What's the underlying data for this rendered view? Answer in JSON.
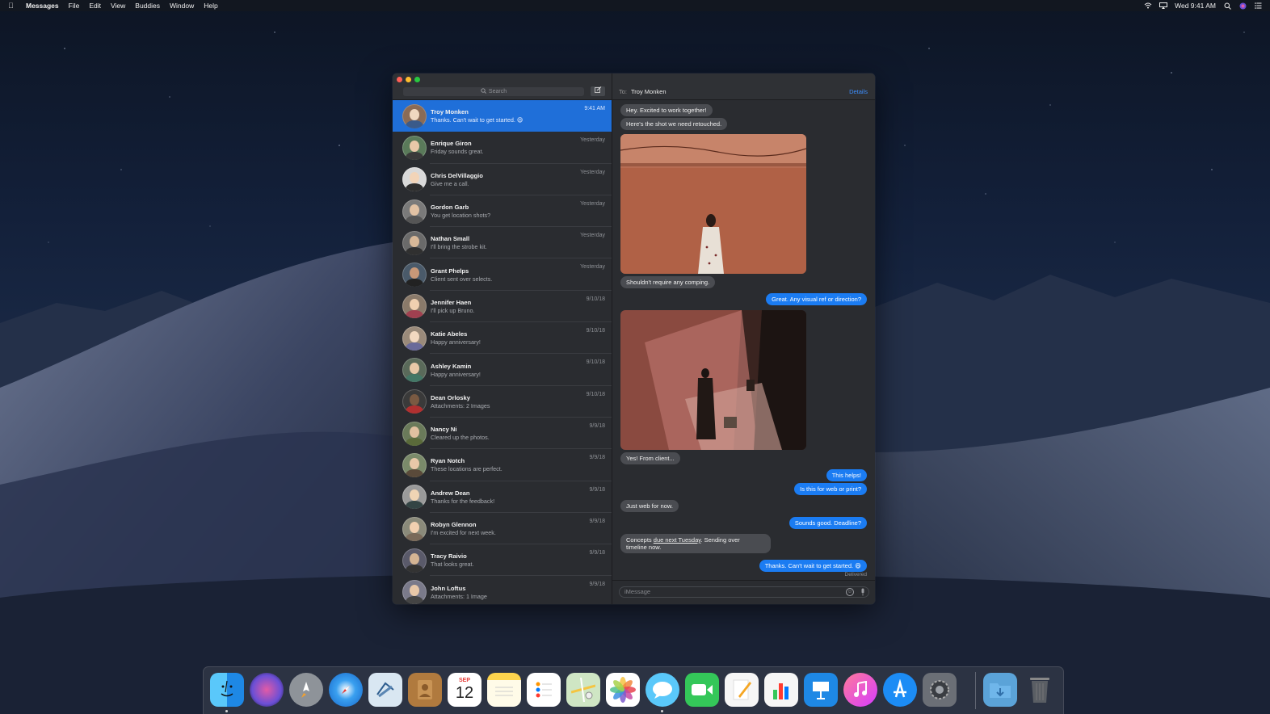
{
  "menubar": {
    "apple_icon": "apple-icon",
    "app_name": "Messages",
    "menus": [
      "File",
      "Edit",
      "View",
      "Buddies",
      "Window",
      "Help"
    ],
    "clock": "Wed 9:41 AM",
    "status_icons": [
      "wifi-icon",
      "airplay-icon",
      "spotlight-icon",
      "siri-icon",
      "notification-center-icon"
    ]
  },
  "window": {
    "search_placeholder": "Search",
    "compose_icon": "compose-icon",
    "conversations": [
      {
        "name": "Troy Monken",
        "preview": "Thanks. Can't wait to get started. 😄",
        "date": "9:41 AM",
        "active": true
      },
      {
        "name": "Enrique Giron",
        "preview": "Friday sounds great.",
        "date": "Yesterday"
      },
      {
        "name": "Chris DelVillaggio",
        "preview": "Give me a call.",
        "date": "Yesterday"
      },
      {
        "name": "Gordon Garb",
        "preview": "You get location shots?",
        "date": "Yesterday"
      },
      {
        "name": "Nathan Small",
        "preview": "I'll bring the strobe kit.",
        "date": "Yesterday"
      },
      {
        "name": "Grant Phelps",
        "preview": "Client sent over selects.",
        "date": "Yesterday"
      },
      {
        "name": "Jennifer Haen",
        "preview": "I'll pick up Bruno.",
        "date": "9/10/18"
      },
      {
        "name": "Katie Abeles",
        "preview": "Happy anniversary!",
        "date": "9/10/18"
      },
      {
        "name": "Ashley Kamin",
        "preview": "Happy anniversary!",
        "date": "9/10/18"
      },
      {
        "name": "Dean Orlosky",
        "preview": "Attachments: 2 Images",
        "date": "9/10/18"
      },
      {
        "name": "Nancy Ni",
        "preview": "Cleared up the photos.",
        "date": "9/9/18"
      },
      {
        "name": "Ryan Notch",
        "preview": "These locations are perfect.",
        "date": "9/9/18"
      },
      {
        "name": "Andrew Dean",
        "preview": "Thanks for the feedback!",
        "date": "9/9/18"
      },
      {
        "name": "Robyn Glennon",
        "preview": "I'm excited for next week.",
        "date": "9/9/18"
      },
      {
        "name": "Tracy Raivio",
        "preview": "That looks great.",
        "date": "9/9/18"
      },
      {
        "name": "John Loftus",
        "preview": "Attachments: 1 Image",
        "date": "9/9/18"
      }
    ],
    "chat": {
      "to_label": "To:",
      "recipient": "Troy Monken",
      "details_label": "Details",
      "messages": [
        {
          "dir": "in",
          "text": "Hey. Excited to work together!"
        },
        {
          "dir": "in",
          "text": "Here's the shot we need retouched."
        },
        {
          "dir": "in",
          "text": "Shouldn't require any comping."
        },
        {
          "dir": "out",
          "text": "Great. Any visual ref or direction?"
        },
        {
          "dir": "in",
          "text": "Yes! From client..."
        },
        {
          "dir": "out",
          "text": "This helps!"
        },
        {
          "dir": "out",
          "text": "Is this for web or print?"
        },
        {
          "dir": "in",
          "text": "Just web for now."
        },
        {
          "dir": "out",
          "text": "Sounds good. Deadline?"
        },
        {
          "dir": "in",
          "text_a": "Concepts ",
          "text_link": "due next Tuesday",
          "text_b": ". Sending over",
          "text_c": "timeline now."
        },
        {
          "dir": "out",
          "text": "Thanks. Can't wait to get started. 😄"
        }
      ],
      "delivered": "Delivered",
      "input_placeholder": "iMessage"
    }
  },
  "dock": {
    "apps": [
      "Finder",
      "Siri",
      "Launchpad",
      "Safari",
      "Mail",
      "Contacts",
      "Calendar",
      "Notes",
      "Reminders",
      "Maps",
      "Photos",
      "Messages",
      "FaceTime",
      "Pages",
      "Numbers",
      "Keynote",
      "iTunes",
      "App Store",
      "System Preferences",
      "Downloads",
      "Trash"
    ],
    "calendar_month": "SEP",
    "calendar_day": "12"
  }
}
